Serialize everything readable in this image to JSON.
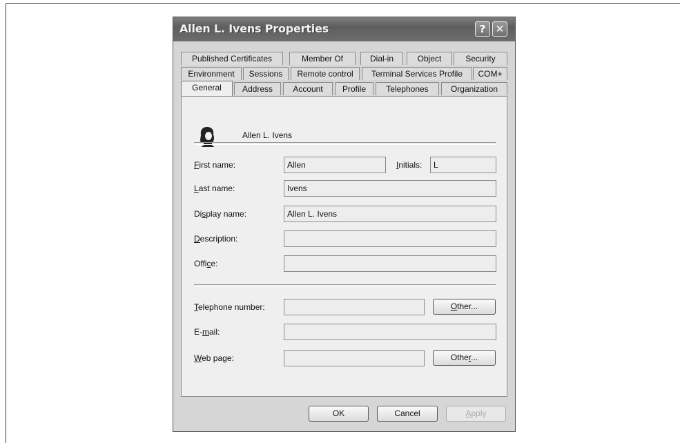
{
  "window": {
    "title": "Allen L. Ivens Properties",
    "help_glyph": "?",
    "close_glyph": "✕"
  },
  "tabs": {
    "row1": [
      "Published Certificates",
      "Member Of",
      "Dial-in",
      "Object",
      "Security"
    ],
    "row2": [
      "Environment",
      "Sessions",
      "Remote control",
      "Terminal Services Profile",
      "COM+"
    ],
    "row3": [
      "General",
      "Address",
      "Account",
      "Profile",
      "Telephones",
      "Organization"
    ],
    "active": "General"
  },
  "general": {
    "display_header": "Allen L. Ivens",
    "first_name": {
      "label": "First name:",
      "value": "Allen"
    },
    "initials": {
      "label": "Initials:",
      "value": "L"
    },
    "last_name": {
      "label": "Last name:",
      "value": "Ivens"
    },
    "display_name": {
      "label": "Display name:",
      "value": "Allen L. Ivens"
    },
    "description": {
      "label": "Description:",
      "value": ""
    },
    "office": {
      "label": "Office:",
      "value": ""
    },
    "telephone": {
      "label": "Telephone number:",
      "value": "",
      "other_label": "Other..."
    },
    "email": {
      "label": "E-mail:",
      "value": ""
    },
    "webpage": {
      "label": "Web page:",
      "value": "",
      "other_label": "Other..."
    }
  },
  "footer": {
    "ok": "OK",
    "cancel": "Cancel",
    "apply": "Apply"
  },
  "colors": {
    "titlebar": "#6a6a6a",
    "dialog_bg": "#d6d6d6",
    "panel_bg": "#efefef"
  }
}
